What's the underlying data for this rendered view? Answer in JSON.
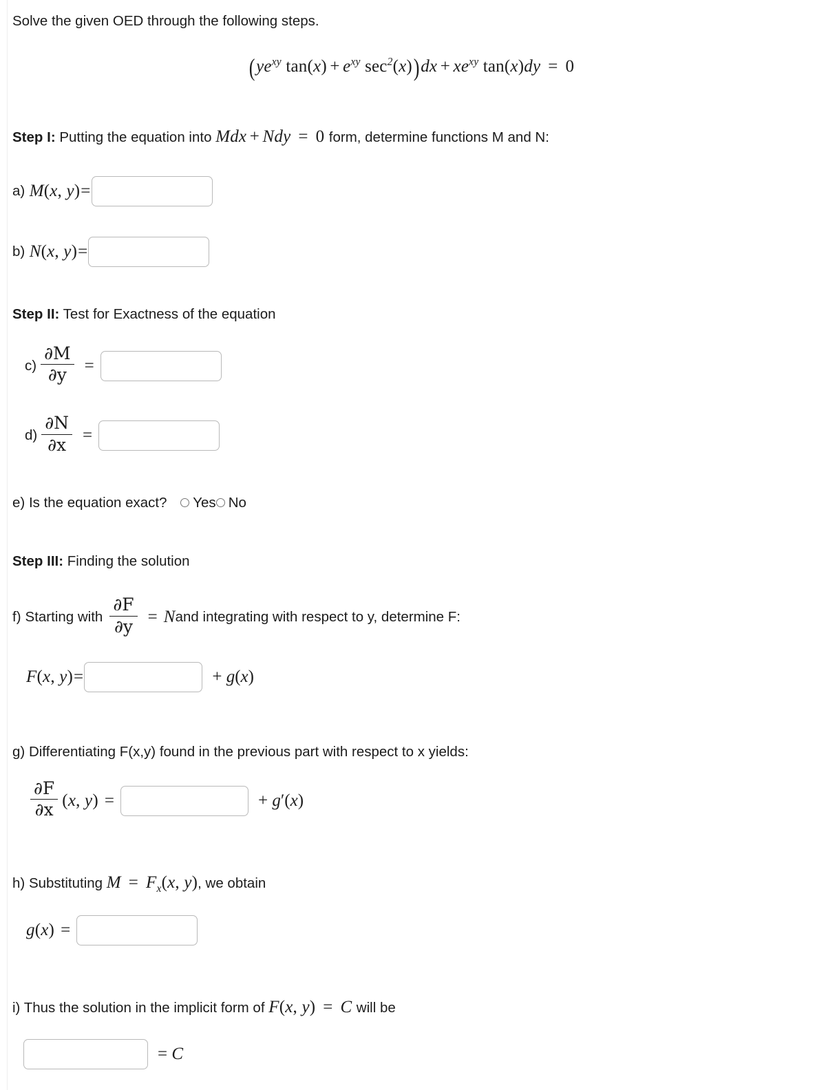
{
  "prompt": {
    "instruction": "Solve the given OED through the following steps.",
    "equation_plain": "(ye^{xy} tan(x) + e^{xy} sec^2(x)) dx + x e^{xy} tan(x) dy = 0"
  },
  "step1": {
    "label": "Step I:",
    "text_before": "Putting the equation into",
    "inline_math": "Mdx + Ndy = 0",
    "text_after": "form, determine functions M and N:",
    "items": [
      {
        "marker": "a)",
        "lhs": "M(x, y)",
        "equals": "=",
        "value": "",
        "placeholder": ""
      },
      {
        "marker": "b)",
        "lhs": "N(x, y)",
        "equals": "=",
        "value": "",
        "placeholder": ""
      }
    ]
  },
  "step2": {
    "label": "Step II:",
    "text": "Test for Exactness of the equation",
    "items": [
      {
        "marker": "c)",
        "num": "∂M",
        "den": "∂y",
        "equals": "=",
        "value": "",
        "placeholder": ""
      },
      {
        "marker": "d)",
        "num": "∂N",
        "den": "∂x",
        "equals": "=",
        "value": "",
        "placeholder": ""
      }
    ],
    "exact_question": {
      "marker": "e)",
      "text": "Is the equation exact?",
      "options": [
        {
          "label": "Yes",
          "selected": false
        },
        {
          "label": "No",
          "selected": false
        }
      ]
    }
  },
  "step3": {
    "label": "Step III:",
    "text": "Finding the solution",
    "f": {
      "marker": "f)",
      "text_before": "Starting with",
      "num": "∂F",
      "den": "∂y",
      "equals": "=",
      "rhs_symbol": "N",
      "text_after": "and integrating with respect to y, determine F:",
      "answer_lhs": "F(x, y)",
      "answer_equals": "=",
      "value": "",
      "placeholder": "",
      "tail": "+ g(x)"
    },
    "g": {
      "marker": "g)",
      "text": "Differentiating F(x,y) found in the previous part with respect to x yields:",
      "num": "∂F",
      "den": "∂x",
      "args": "(x, y)",
      "equals": "=",
      "value": "",
      "placeholder": "",
      "tail": "+ g′(x)"
    },
    "h": {
      "marker": "h)",
      "text_before": "Substituting",
      "inline_math": "M = Fx(x, y)",
      "text_after": ", we obtain",
      "answer_lhs": "g(x)",
      "answer_equals": "=",
      "value": "",
      "placeholder": ""
    },
    "i": {
      "marker": "i)",
      "text_before": "Thus the solution in the implicit form of",
      "inline_math": "F(x, y) = C",
      "text_after": "will be",
      "value": "",
      "placeholder": "",
      "tail": "= C"
    }
  },
  "colors": {
    "text": "#1c1c1c",
    "box_border": "#b9b9b9",
    "page_background": "#ffffff",
    "rule": "#eeeeee"
  }
}
